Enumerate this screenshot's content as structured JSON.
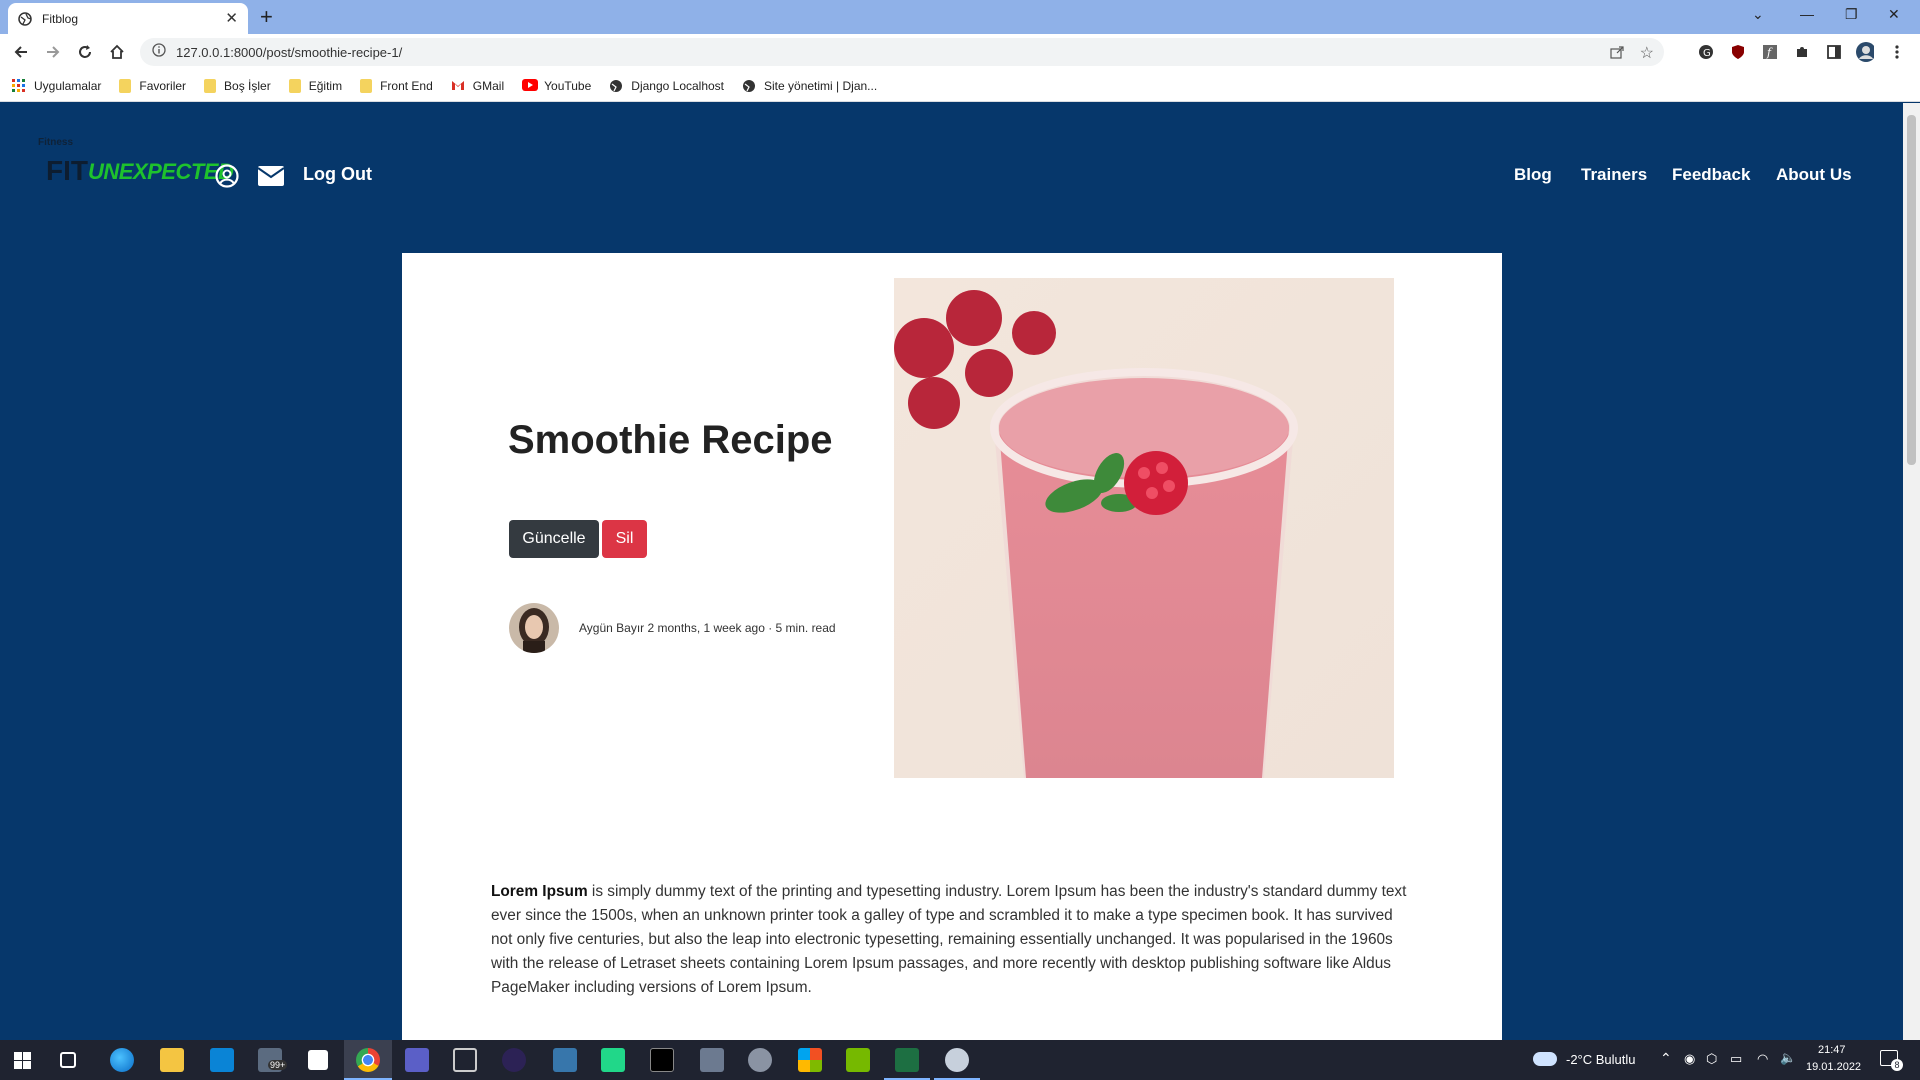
{
  "browser": {
    "tab_title": "Fitblog",
    "url": "127.0.0.1:8000/post/smoothie-recipe-1/",
    "bookmarks": [
      {
        "label": "Uygulamalar",
        "icon": "apps-grid-icon"
      },
      {
        "label": "Favoriler",
        "icon": "folder-icon"
      },
      {
        "label": "Boş İşler",
        "icon": "folder-icon"
      },
      {
        "label": "Eğitim",
        "icon": "folder-icon"
      },
      {
        "label": "Front End",
        "icon": "folder-icon"
      },
      {
        "label": "GMail",
        "icon": "gmail-icon"
      },
      {
        "label": "YouTube",
        "icon": "youtube-icon"
      },
      {
        "label": "Django Localhost",
        "icon": "globe-icon"
      },
      {
        "label": "Site yönetimi | Djan...",
        "icon": "globe-icon"
      }
    ]
  },
  "site": {
    "logo_small": "Fitness",
    "logo_fit": "FIT",
    "logo_text": "UNEXPECTED",
    "logout": "Log Out",
    "menu": [
      "Blog",
      "Trainers",
      "Feedback",
      "About Us"
    ]
  },
  "post": {
    "title": "Smoothie Recipe",
    "update_label": "Güncelle",
    "delete_label": "Sil",
    "meta": "Aygün Bayır 2 months, 1 week ago · 5 min. read",
    "lead": "Lorem Ipsum",
    "body": " is simply dummy text of the printing and typesetting industry. Lorem Ipsum has been the industry's standard dummy text ever since the 1500s, when an unknown printer took a galley of type and scrambled it to make a type specimen book. It has survived not only five centuries, but also the leap into electronic typesetting, remaining essentially unchanged. It was popularised in the 1960s with the release of Letraset sheets containing Lorem Ipsum passages, and more recently with desktop publishing software like Aldus PageMaker including versions of Lorem Ipsum."
  },
  "taskbar": {
    "weather": "-2°C  Bulutlu",
    "time": "21:47",
    "date": "19.01.2022",
    "mail_badge": "99+",
    "notif_count": "8"
  },
  "colors": {
    "page_bg": "#06376b",
    "logo_green": "#1ec22d",
    "update_btn": "#343a40",
    "delete_btn": "#dc3545"
  }
}
